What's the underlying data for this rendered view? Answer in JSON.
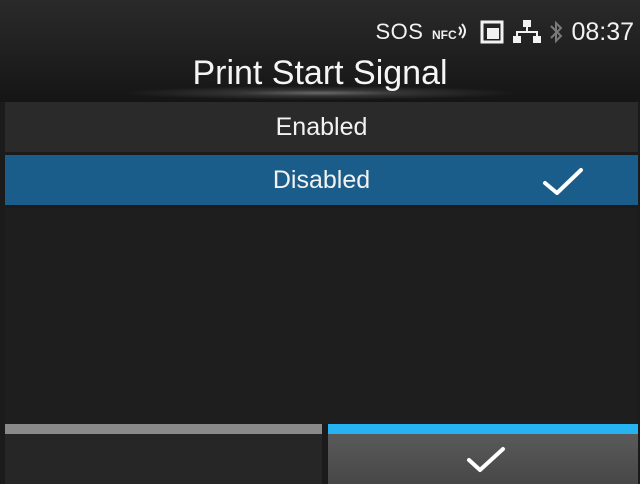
{
  "status_bar": {
    "sos": "SOS",
    "nfc_label": "NFC",
    "time": "08:37",
    "icons": [
      "nfc-icon",
      "sd-card-icon",
      "network-icon",
      "bluetooth-icon"
    ]
  },
  "header": {
    "title": "Print Start Signal"
  },
  "options": [
    {
      "label": "Enabled",
      "selected": false
    },
    {
      "label": "Disabled",
      "selected": true
    }
  ],
  "bottom": {
    "confirm_icon": "check-icon"
  },
  "colors": {
    "selected_row": "#1b5d8a",
    "accent": "#27b3f2",
    "inactive_bar": "#8a8a8a"
  }
}
